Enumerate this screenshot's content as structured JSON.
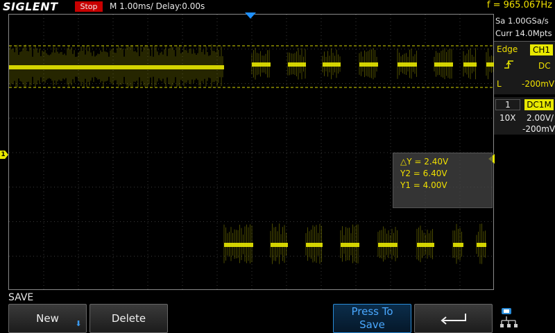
{
  "header": {
    "brand": "SIGLENT",
    "run_state": "Stop",
    "timebase": "M 1.00ms/ Delay:0.00s",
    "frequency": "f = 965.067Hz"
  },
  "acquisition": {
    "sample_rate": "Sa 1.00GSa/s",
    "memory_depth": "Curr 14.0Mpts"
  },
  "trigger": {
    "type": "Edge",
    "source": "CH1",
    "slope_icon": "rising-edge-icon",
    "coupling": "DC",
    "level_label": "L",
    "level": "-200mV"
  },
  "channel": {
    "number": "1",
    "coupling": "DC1M",
    "probe": "10X",
    "scale": "2.00V/",
    "offset": "-200mV"
  },
  "cursors": {
    "delta_y": "△Y = 2.40V",
    "y2": "Y2 = 6.40V",
    "y1": "Y1 = 4.00V"
  },
  "markers": {
    "channel_marker": "1"
  },
  "menu": {
    "title": "SAVE",
    "new_label": "New",
    "delete_label": "Delete",
    "press_to_save_line1": "Press To",
    "press_to_save_line2": "Save",
    "return_icon": "return-arrow-icon",
    "network_icon": "network-icon"
  },
  "colors": {
    "trace": "#e8e800",
    "stop": "#c80000",
    "trigger_marker": "#1e90ff",
    "active_key": "#2a8cd8"
  }
}
